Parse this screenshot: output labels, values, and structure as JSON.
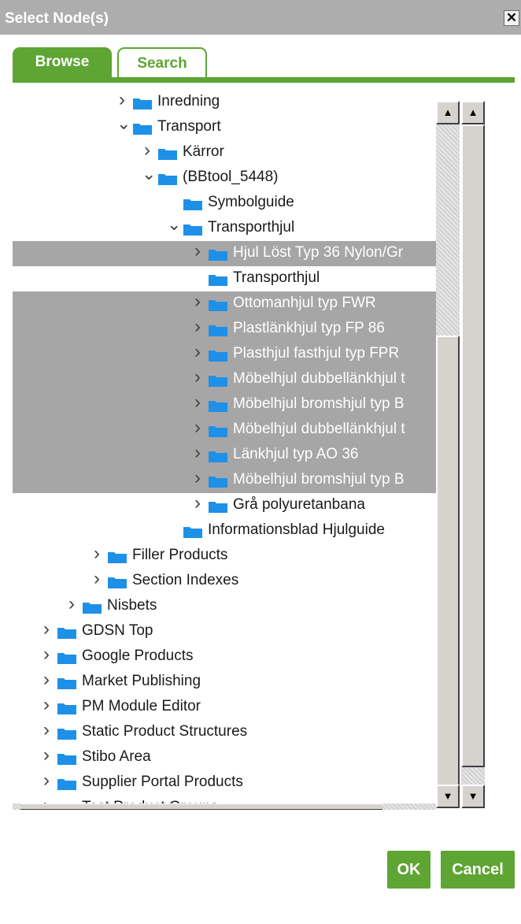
{
  "dialog": {
    "title": "Select Node(s)",
    "close_symbol": "✕",
    "tabs": [
      {
        "label": "Browse",
        "active": true
      },
      {
        "label": "Search",
        "active": false
      }
    ],
    "ok_label": "OK",
    "cancel_label": "Cancel"
  },
  "tree": {
    "folder_color": "#1e90e8",
    "selection_color": "#a6a6a6",
    "nodes": [
      {
        "label": "Inredning",
        "level": 4,
        "expander": "collapsed",
        "selected": false
      },
      {
        "label": "Transport",
        "level": 4,
        "expander": "expanded",
        "selected": false
      },
      {
        "label": "Kärror",
        "level": 5,
        "expander": "collapsed",
        "selected": false
      },
      {
        "label": "(BBtool_5448)",
        "level": 5,
        "expander": "expanded",
        "selected": false
      },
      {
        "label": "Symbolguide",
        "level": 6,
        "expander": "none",
        "selected": false
      },
      {
        "label": "Transporthjul",
        "level": 6,
        "expander": "expanded",
        "selected": false
      },
      {
        "label": "Hjul Löst Typ 36 Nylon/Gr",
        "level": 7,
        "expander": "collapsed",
        "selected": true
      },
      {
        "label": "Transporthjul",
        "level": 7,
        "expander": "none",
        "selected": false
      },
      {
        "label": "Ottomanhjul typ FWR",
        "level": 7,
        "expander": "collapsed",
        "selected": true
      },
      {
        "label": "Plastlänkhjul typ FP 86",
        "level": 7,
        "expander": "collapsed",
        "selected": true
      },
      {
        "label": "Plasthjul fasthjul typ FPR",
        "level": 7,
        "expander": "collapsed",
        "selected": true
      },
      {
        "label": "Möbelhjul dubbellänkhjul t",
        "level": 7,
        "expander": "collapsed",
        "selected": true
      },
      {
        "label": "Möbelhjul bromshjul typ B",
        "level": 7,
        "expander": "collapsed",
        "selected": true
      },
      {
        "label": "Möbelhjul dubbellänkhjul t",
        "level": 7,
        "expander": "collapsed",
        "selected": true
      },
      {
        "label": "Länkhjul typ AO 36",
        "level": 7,
        "expander": "collapsed",
        "selected": true
      },
      {
        "label": "Möbelhjul bromshjul typ B",
        "level": 7,
        "expander": "collapsed",
        "selected": true
      },
      {
        "label": "Grå polyuretanbana",
        "level": 7,
        "expander": "collapsed",
        "selected": false
      },
      {
        "label": "Informationsblad Hjulguide",
        "level": 6,
        "expander": "none",
        "selected": false
      },
      {
        "label": "Filler Products",
        "level": 3,
        "expander": "collapsed",
        "selected": false
      },
      {
        "label": "Section Indexes",
        "level": 3,
        "expander": "collapsed",
        "selected": false
      },
      {
        "label": "Nisbets",
        "level": 2,
        "expander": "collapsed",
        "selected": false
      },
      {
        "label": "GDSN Top",
        "level": 1,
        "expander": "collapsed",
        "selected": false
      },
      {
        "label": "Google Products",
        "level": 1,
        "expander": "collapsed",
        "selected": false
      },
      {
        "label": "Market Publishing",
        "level": 1,
        "expander": "collapsed",
        "selected": false
      },
      {
        "label": "PM Module Editor",
        "level": 1,
        "expander": "collapsed",
        "selected": false
      },
      {
        "label": "Static Product Structures",
        "level": 1,
        "expander": "collapsed",
        "selected": false
      },
      {
        "label": "Stibo Area",
        "level": 1,
        "expander": "collapsed",
        "selected": false
      },
      {
        "label": "Supplier Portal Products",
        "level": 1,
        "expander": "collapsed",
        "selected": false
      },
      {
        "label": "Test Product Groups",
        "level": 1,
        "expander": "collapsed",
        "selected": false
      }
    ]
  },
  "scrollbars": {
    "up_arrow": "▲",
    "down_arrow": "▼"
  }
}
